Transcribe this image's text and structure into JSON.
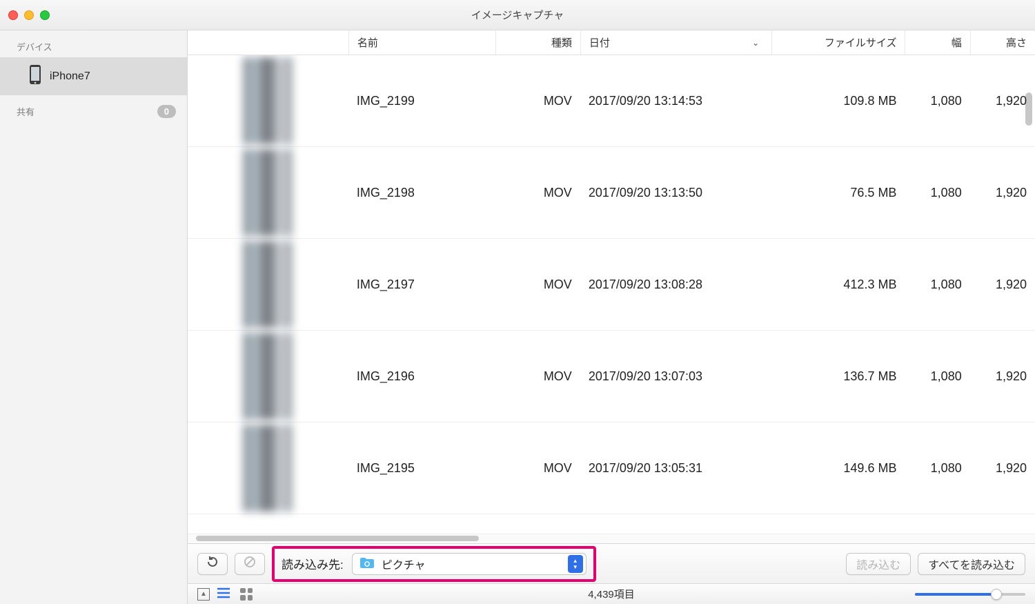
{
  "window": {
    "title": "イメージキャプチャ"
  },
  "sidebar": {
    "devices_heading": "デバイス",
    "device_name": "iPhone7",
    "shared_heading": "共有",
    "shared_badge": "0"
  },
  "columns": {
    "name": "名前",
    "kind": "種類",
    "date": "日付",
    "filesize": "ファイルサイズ",
    "width": "幅",
    "height": "高さ"
  },
  "rows": [
    {
      "name": "IMG_2199",
      "kind": "MOV",
      "date": "2017/09/20 13:14:53",
      "size": "109.8 MB",
      "width": "1,080",
      "height": "1,920"
    },
    {
      "name": "IMG_2198",
      "kind": "MOV",
      "date": "2017/09/20 13:13:50",
      "size": "76.5 MB",
      "width": "1,080",
      "height": "1,920"
    },
    {
      "name": "IMG_2197",
      "kind": "MOV",
      "date": "2017/09/20 13:08:28",
      "size": "412.3 MB",
      "width": "1,080",
      "height": "1,920"
    },
    {
      "name": "IMG_2196",
      "kind": "MOV",
      "date": "2017/09/20 13:07:03",
      "size": "136.7 MB",
      "width": "1,080",
      "height": "1,920"
    },
    {
      "name": "IMG_2195",
      "kind": "MOV",
      "date": "2017/09/20 13:05:31",
      "size": "149.6 MB",
      "width": "1,080",
      "height": "1,920"
    }
  ],
  "toolbar": {
    "import_to_label": "読み込み先:",
    "destination": "ピクチャ",
    "import_button": "読み込む",
    "import_all_button": "すべてを読み込む"
  },
  "status": {
    "item_count": "4,439項目"
  }
}
